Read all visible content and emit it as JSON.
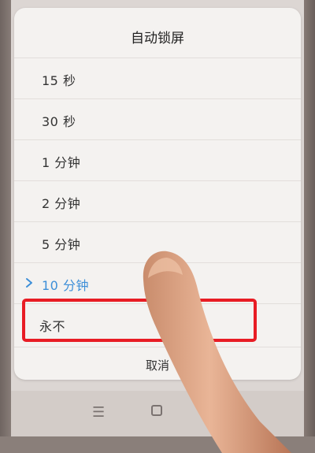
{
  "dialog": {
    "title": "自动锁屏",
    "options": [
      {
        "label": "15 秒",
        "selected": false
      },
      {
        "label": "30 秒",
        "selected": false
      },
      {
        "label": "1 分钟",
        "selected": false
      },
      {
        "label": "2 分钟",
        "selected": false
      },
      {
        "label": "5 分钟",
        "selected": false
      },
      {
        "label": "10 分钟",
        "selected": true
      },
      {
        "label": "永不",
        "selected": false
      }
    ],
    "cancel_label": "取消"
  },
  "nav": {
    "menu_icon": "menu-icon",
    "home_icon": "home-icon"
  },
  "colors": {
    "selected_accent": "#3d8fd8",
    "highlight_box": "#e81c24"
  }
}
